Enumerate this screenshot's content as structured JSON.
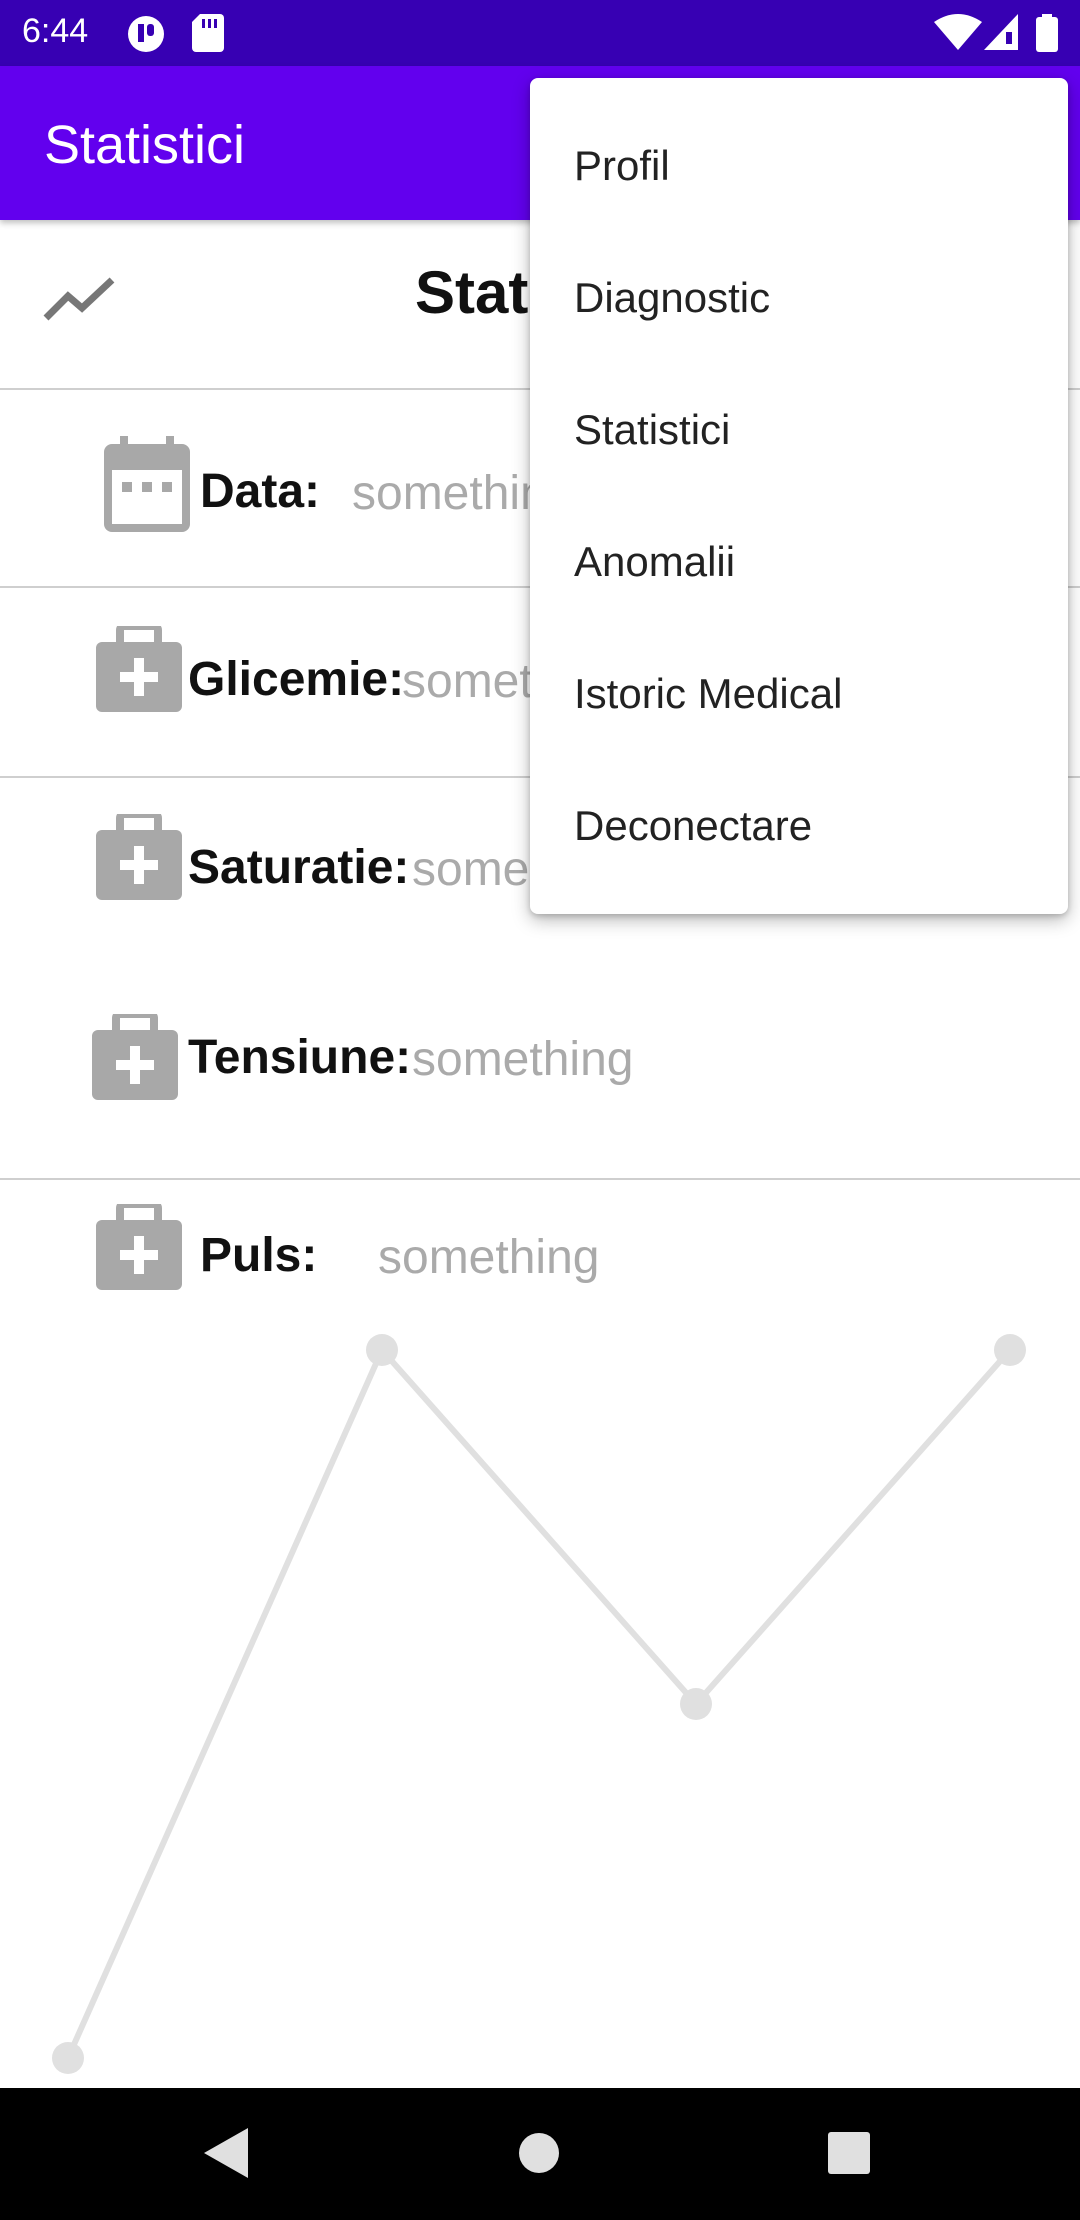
{
  "status_bar": {
    "time": "6:44"
  },
  "app_bar": {
    "title": "Statistici"
  },
  "header": {
    "title": "Statistici"
  },
  "fields": [
    {
      "label": "Data:",
      "value": "something"
    },
    {
      "label": "Glicemie:",
      "value": "something"
    },
    {
      "label": "Saturatie:",
      "value": "something"
    },
    {
      "label": "Tensiune:",
      "value": "something"
    },
    {
      "label": "Puls:",
      "value": "something"
    }
  ],
  "overflow_menu": {
    "items": [
      "Profil",
      "Diagnostic",
      "Statistici",
      "Anomalii",
      "Istoric Medical",
      "Deconectare"
    ]
  },
  "chart_data": {
    "type": "line",
    "x": [
      0,
      1,
      2,
      3
    ],
    "values": [
      0,
      1,
      0.5,
      1
    ],
    "color": "#e0e0e0"
  },
  "colors": {
    "primary": "#6200ee",
    "primary_dark": "#3700b3"
  }
}
